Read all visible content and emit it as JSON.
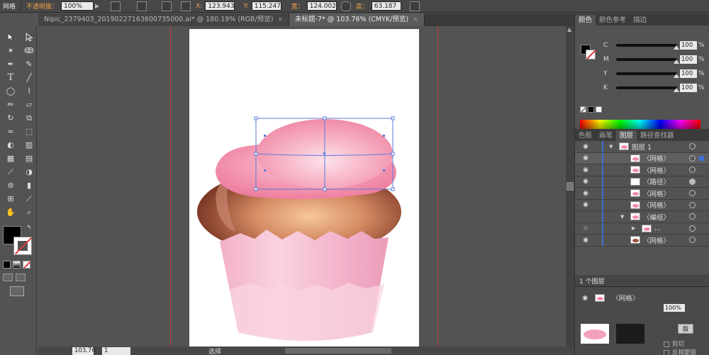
{
  "control_bar": {
    "object_type": "网格",
    "opacity_label": "不透明度：",
    "opacity_value": "100%",
    "x_label": "X:",
    "x_value": "123.943",
    "y_label": "Y:",
    "y_value": "115.247",
    "width_label": "宽：",
    "width_value": "124.002",
    "height_label": "高：",
    "height_value": "63.187"
  },
  "tabs": [
    {
      "label": "Nipic_2379403_20190227163600735000.ai* @ 180.19% (RGB/预览)",
      "close": "×"
    },
    {
      "label": "未标题-7* @ 103.76% (CMYK/预览)",
      "close": "×"
    }
  ],
  "status_bar": {
    "zoom": "103.76",
    "page": "1",
    "tool": "选择"
  },
  "color_panel": {
    "tabs": [
      "颜色",
      "颜色参考",
      "描边"
    ],
    "channels": [
      {
        "name": "C",
        "value": "100",
        "unit": "%"
      },
      {
        "name": "M",
        "value": "100",
        "unit": "%"
      },
      {
        "name": "Y",
        "value": "100",
        "unit": "%"
      },
      {
        "name": "K",
        "value": "100",
        "unit": "%"
      }
    ]
  },
  "layers_panel": {
    "tabs": [
      "色板",
      "画笔",
      "图层",
      "路径查找器"
    ],
    "rows": [
      {
        "label": "图层 1"
      },
      {
        "label": "〈网格〉"
      },
      {
        "label": "〈网格〉"
      },
      {
        "label": "〈路径〉"
      },
      {
        "label": "〈网格〉"
      },
      {
        "label": "〈网格〉"
      },
      {
        "label": "〈编组〉"
      },
      {
        "label": "..."
      },
      {
        "label": "〈网格〉"
      }
    ],
    "footer": "1 个图层"
  },
  "transparency_panel": {
    "item_label": "〈网格〉",
    "opacity": "100%",
    "button": "版",
    "clip_label": "剪切",
    "invert_label": "反相蒙版"
  },
  "colors": {
    "accent_orange": "#f3a24a",
    "selection_blue": "#3f6fd6",
    "guide_red": "#c23a3a",
    "frosting_pink": "#f08ca8",
    "cup_pink": "#f5b8cf",
    "cake_brown": "#9b4a33"
  }
}
